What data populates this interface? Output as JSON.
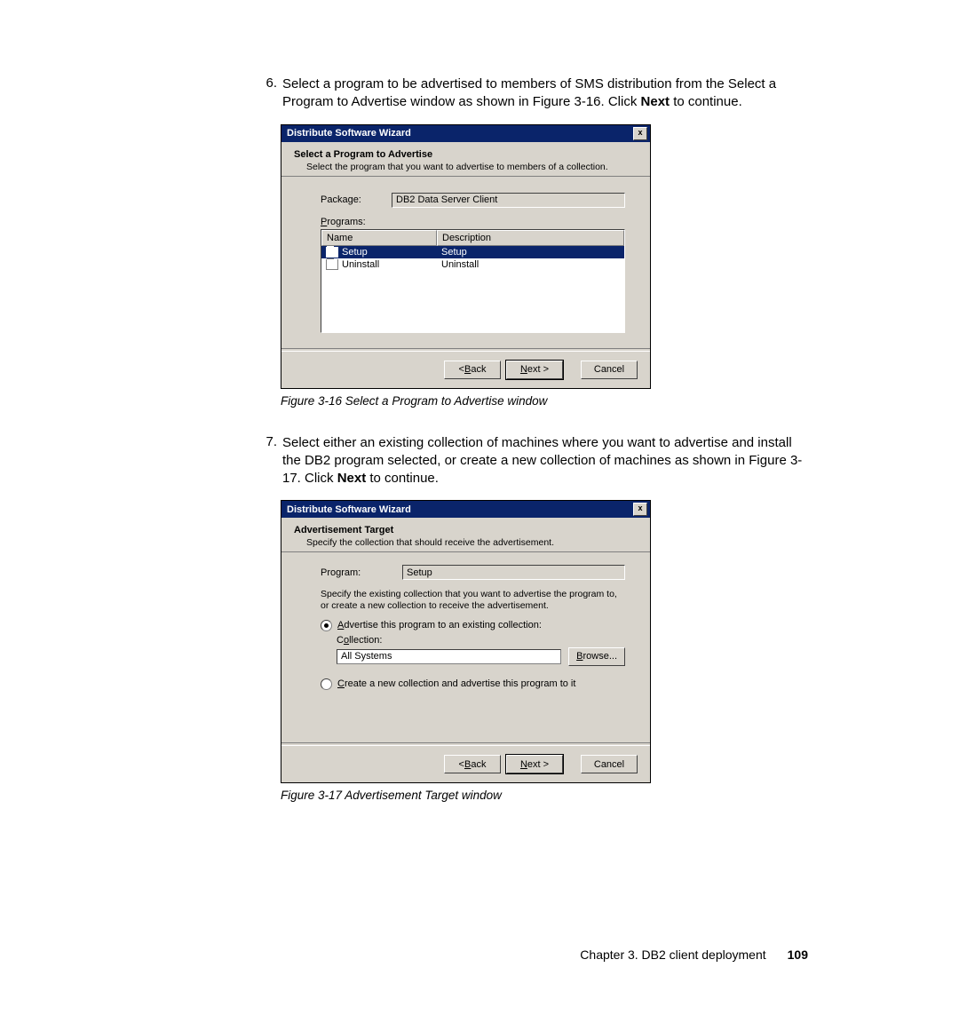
{
  "steps": {
    "s6": {
      "num": "6.",
      "text_a": "Select a program to be advertised to members of SMS distribution from the Select a Program to Advertise window as shown in Figure 3-16. Click ",
      "bold": "Next",
      "text_b": " to continue."
    },
    "s7": {
      "num": "7.",
      "text_a": "Select either an existing collection of machines where you want to advertise and install the DB2 program selected, or create a new collection of machines as shown in Figure 3-17. Click ",
      "bold": "Next",
      "text_b": " to continue."
    }
  },
  "captions": {
    "c1": "Figure 3-16   Select a Program to Advertise window",
    "c2": "Figure 3-17   Advertisement Target window"
  },
  "wiz_common": {
    "title": "Distribute Software Wizard",
    "close": "x"
  },
  "wiz1": {
    "head_title": "Select a Program to Advertise",
    "head_desc": "Select the program that you want to advertise to members of a collection.",
    "lbl_package": "Package:",
    "val_package": "DB2 Data Server Client",
    "lbl_programs": "Programs:",
    "col_name": "Name",
    "col_desc": "Description",
    "rows": [
      {
        "name": "Setup",
        "desc": "Setup",
        "selected": true
      },
      {
        "name": "Uninstall",
        "desc": "Uninstall",
        "selected": false
      }
    ]
  },
  "wiz2": {
    "head_title": "Advertisement Target",
    "head_desc": "Specify the collection that should receive the advertisement.",
    "lbl_program": "Program:",
    "val_program": "Setup",
    "para": "Specify the existing collection that you want to advertise the program to, or create a new collection to receive the advertisement.",
    "radio1": "Advertise this program to an existing collection:",
    "lbl_collection": "Collection:",
    "val_collection": "All Systems",
    "btn_browse": "Browse...",
    "radio2": "Create a new collection and advertise this program to it"
  },
  "buttons": {
    "back": "< Back",
    "next": "Next >",
    "cancel": "Cancel"
  },
  "accel": {
    "P": "P",
    "B": "B",
    "N": "N",
    "A": "A",
    "o": "o",
    "C": "C",
    "Br": "B"
  },
  "footer": {
    "chapter": "Chapter 3. DB2 client deployment",
    "page": "109"
  }
}
